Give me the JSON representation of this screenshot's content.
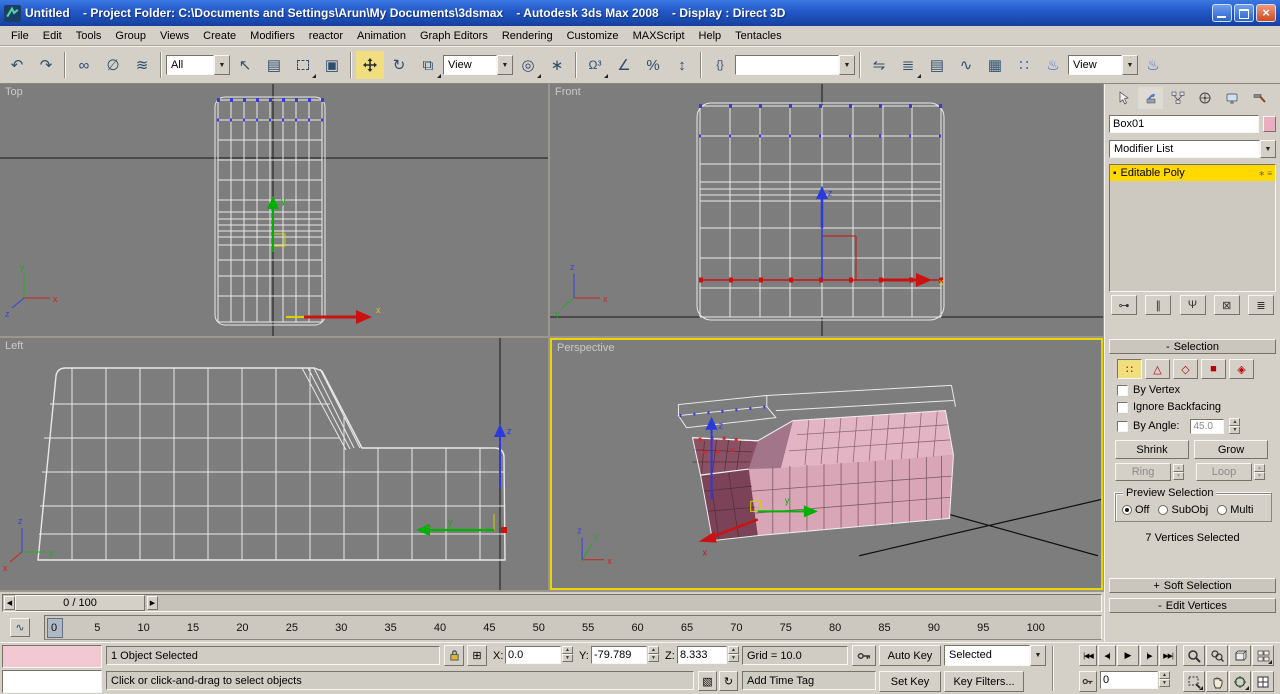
{
  "window": {
    "title": "Untitled    - Project Folder: C:\\Documents and Settings\\Arun\\My Documents\\3dsmax    - Autodesk 3ds Max 2008    - Display : Direct 3D"
  },
  "menubar": {
    "items": [
      "File",
      "Edit",
      "Tools",
      "Group",
      "Views",
      "Create",
      "Modifiers",
      "reactor",
      "Animation",
      "Graph Editors",
      "Rendering",
      "Customize",
      "MAXScript",
      "Help",
      "Tentacles"
    ]
  },
  "toolbar": {
    "selection_filter_value": "All",
    "coordinate_system_value": "View",
    "named_selection_value": "",
    "render_view_value": "View"
  },
  "axes": {
    "x": "x",
    "y": "y",
    "z": "z"
  },
  "viewports": {
    "top_label": "Top",
    "front_label": "Front",
    "left_label": "Left",
    "perspective_label": "Perspective"
  },
  "command_panel": {
    "object_name": "Box01",
    "modifier_list_label": "Modifier List",
    "stack_item": "Editable Poly",
    "selection": {
      "header_state": "-",
      "header": "Selection",
      "by_vertex": "By Vertex",
      "ignore_backfacing": "Ignore Backfacing",
      "by_angle": "By Angle:",
      "by_angle_value": "45.0",
      "shrink": "Shrink",
      "grow": "Grow",
      "ring": "Ring",
      "loop": "Loop",
      "preview_title": "Preview Selection",
      "preview_off": "Off",
      "preview_subobj": "SubObj",
      "preview_multi": "Multi",
      "status": "7 Vertices Selected"
    },
    "soft_selection_state": "+",
    "soft_selection_header": "Soft Selection",
    "edit_vertices_state": "-",
    "edit_vertices_header": "Edit Vertices"
  },
  "timeline": {
    "slider_label": "0 / 100",
    "ticks": [
      "0",
      "5",
      "10",
      "15",
      "20",
      "25",
      "30",
      "35",
      "40",
      "45",
      "50",
      "55",
      "60",
      "65",
      "70",
      "75",
      "80",
      "85",
      "90",
      "95",
      "100"
    ]
  },
  "status_bar": {
    "selection_status": "1 Object Selected",
    "x_label": "X:",
    "x_value": "0.0",
    "y_label": "Y:",
    "y_value": "-79.789",
    "z_label": "Z:",
    "z_value": "8.333",
    "grid_label": "Grid = 10.0",
    "prompt": "Click or click-and-drag to select objects",
    "add_time_tag": "Add Time Tag",
    "auto_key": "Auto Key",
    "set_key": "Set Key",
    "selected_value": "Selected",
    "key_filters": "Key Filters...",
    "frame_value": "0"
  },
  "icons": {
    "undo": "↶",
    "redo": "↷",
    "link": "∞",
    "unlink": "∅",
    "bind_spacewarp": "≋",
    "select": "↖",
    "select_by_name": "▤",
    "window_crossing": "▣",
    "rotate": "↻",
    "scale": "⧉",
    "use_center": "◎",
    "manipulate": "∗",
    "snap": "Ω³",
    "angle_snap": "∠",
    "percent_snap": "%",
    "spinner_snap": "↕",
    "named_sets": "{}",
    "mirror": "⇋",
    "align": "≣",
    "layers": "▤",
    "curve_editor": "∿",
    "schematic": "▦",
    "material": "∷",
    "teapot": "♨",
    "combo_arrow": "▼",
    "spin_up": "▲",
    "spin_down": "▼",
    "slider_prev": "◀",
    "slider_next": "▶",
    "stack_enabled": "▪",
    "stack_row_extra": "∗ ≡",
    "pin_stack": "⊶",
    "show_end_result": "∥",
    "make_unique": "Ψ",
    "remove_modifier": "⊠",
    "configure_sets": "≣",
    "vertex": "∷",
    "edge": "△",
    "border": "◇",
    "polygon": "■",
    "element": "◈",
    "typein_absolute": "⊞",
    "degradation": "▧",
    "progressive": "↻",
    "go_start": "|◀◀",
    "prev_frame": "◀|",
    "play": "▶",
    "next_frame": "|▶",
    "go_end": "▶▶|",
    "mini_curve": "∿"
  }
}
